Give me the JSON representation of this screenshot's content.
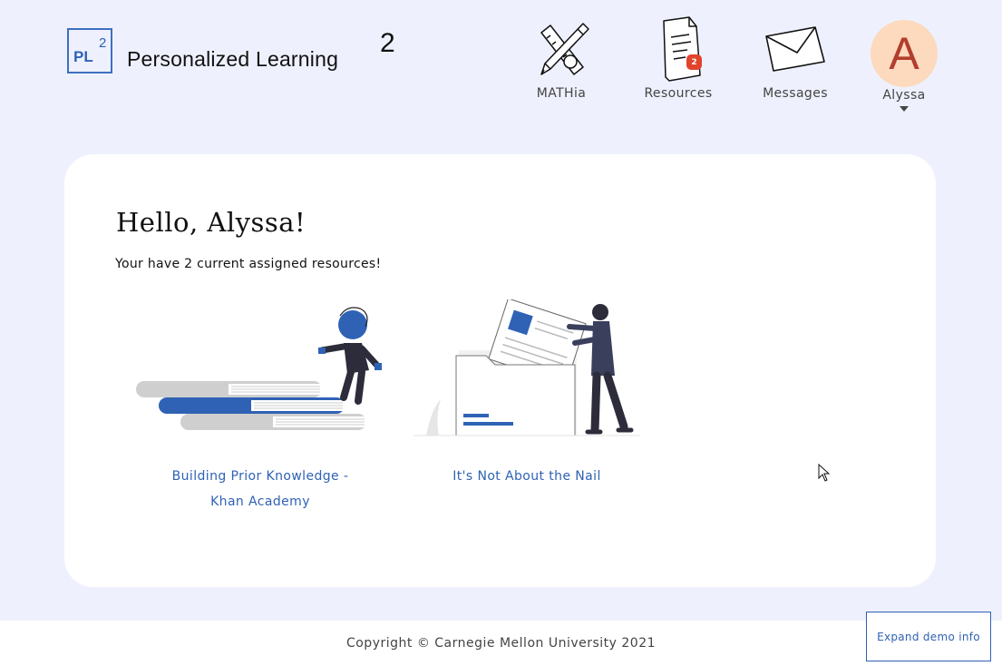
{
  "brand": {
    "logo_abbrev": "PL",
    "logo_superscript": "2",
    "name": "Personalized Learning",
    "name_superscript": "2"
  },
  "nav": {
    "mathia": {
      "label": "MATHia",
      "icon": "pencil-ruler-icon"
    },
    "resources": {
      "label": "Resources",
      "icon": "document-icon",
      "badge": "2"
    },
    "messages": {
      "label": "Messages",
      "icon": "envelope-icon"
    },
    "profile": {
      "label": "Alyssa",
      "avatar_initial": "A",
      "icon": "caret-down-icon"
    }
  },
  "main": {
    "greeting": "Hello, Alyssa!",
    "subtitle": "Your have 2 current assigned resources!",
    "resources": [
      {
        "title_line1": "Building Prior Knowledge -",
        "title_line2": "Khan Academy",
        "icon": "climbing-books-illustration"
      },
      {
        "title_line1": "It's Not About the Nail",
        "icon": "filing-documents-illustration"
      }
    ]
  },
  "footer": {
    "copyright": "Copyright © Carnegie Mellon University 2021",
    "demo_button": "Expand demo info"
  },
  "colors": {
    "background": "#eef1fd",
    "accent": "#2f62b5",
    "badge": "#e0442c",
    "avatar_bg": "#fdd9bd",
    "avatar_text": "#b23e2c"
  }
}
